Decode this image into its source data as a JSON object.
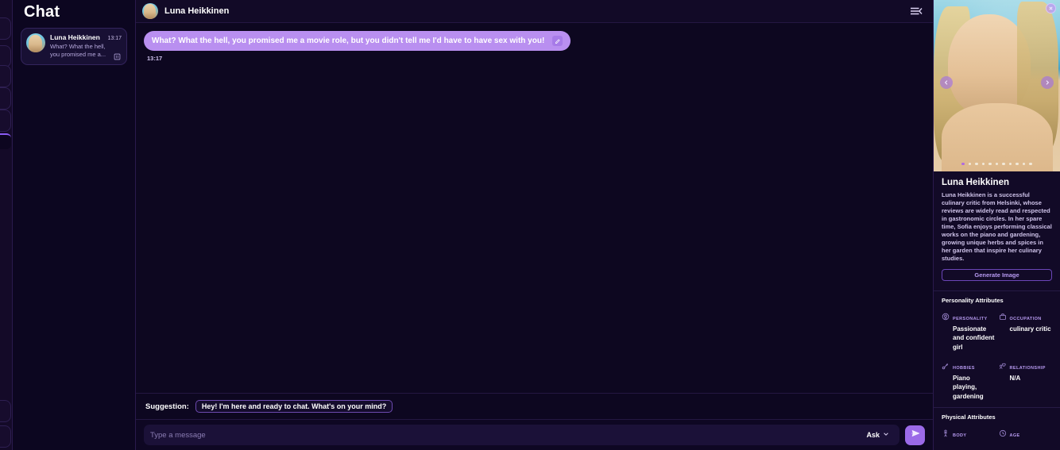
{
  "rail": {
    "buttons": [
      "nav-1",
      "nav-2",
      "nav-3",
      "nav-4",
      "nav-5",
      "nav-6",
      "nav-7",
      "nav-8"
    ]
  },
  "conversations": {
    "title": "Chat",
    "items": [
      {
        "name": "Luna Heikkinen",
        "time": "13:17",
        "snippet": "What? What the hell, you promised me a...",
        "delete_icon": "trash-icon"
      }
    ]
  },
  "chat": {
    "header": {
      "name": "Luna Heikkinen",
      "menu_icon": "menu-collapse-icon"
    },
    "messages": [
      {
        "text": "What? What the hell, you promised me a movie role, but you didn't tell me I'd have to have sex with you!",
        "time": "13:17",
        "edit_icon": "edit-icon"
      }
    ],
    "suggestion": {
      "label": "Suggestion:",
      "text": "Hey! I'm here and ready to chat. What's on your mind?"
    },
    "composer": {
      "placeholder": "Type a message",
      "value": "",
      "ask_label": "Ask",
      "chevron_icon": "chevron-down-icon",
      "send_icon": "send-icon"
    }
  },
  "profile": {
    "hero": {
      "close_icon": "close-icon",
      "prev_icon": "chevron-left-icon",
      "next_icon": "chevron-right-icon",
      "dot_count": 11,
      "active_dot": 0
    },
    "name": "Luna Heikkinen",
    "description": "Luna Heikkinen is a successful culinary critic from Helsinki, whose reviews are widely read and respected in gastronomic circles. In her spare time, Sofia enjoys performing classical works on the piano and gardening, growing unique herbs and spices in her garden that inspire her culinary studies.",
    "generate_button": "Generate Image",
    "personality_section": {
      "title": "Personality Attributes",
      "attributes": [
        {
          "icon": "personality-icon",
          "key": "PERSONALITY",
          "value": "Passionate and confident girl"
        },
        {
          "icon": "briefcase-icon",
          "key": "OCCUPATION",
          "value": "culinary critic"
        },
        {
          "icon": "hobbies-icon",
          "key": "HOBBIES",
          "value": "Piano playing, gardening"
        },
        {
          "icon": "relationship-icon",
          "key": "RELATIONSHIP",
          "value": "N/A"
        }
      ]
    },
    "physical_section": {
      "title": "Physical Attributes",
      "attributes": [
        {
          "icon": "body-icon",
          "key": "BODY",
          "value": ""
        },
        {
          "icon": "age-icon",
          "key": "AGE",
          "value": ""
        }
      ]
    }
  },
  "colors": {
    "accent": "#9b6ae8",
    "bubble": "#b98ff0",
    "panel_bg": "#120a27",
    "app_bg": "#0d0720",
    "label": "#b79af0"
  }
}
